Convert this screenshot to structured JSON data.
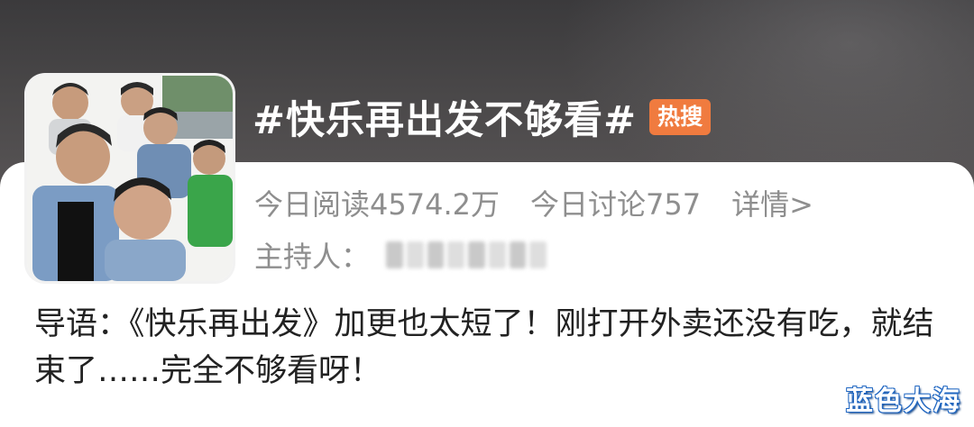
{
  "topic": {
    "title": "#快乐再出发不够看#",
    "badge": "热搜"
  },
  "stats": {
    "reads": "今日阅读4574.2万",
    "discussions": "今日讨论757",
    "details_link": "详情>"
  },
  "host": {
    "label": "主持人："
  },
  "intro": {
    "text": "导语：《快乐再出发》加更也太短了！刚打开外卖还没有吃，就结束了……完全不够看呀！"
  },
  "watermark": "蓝色大海",
  "colors": {
    "badge": "#f07b3f",
    "header_bg": "#4a4849",
    "muted_text": "#8e8e8e",
    "body_text": "#222222"
  }
}
